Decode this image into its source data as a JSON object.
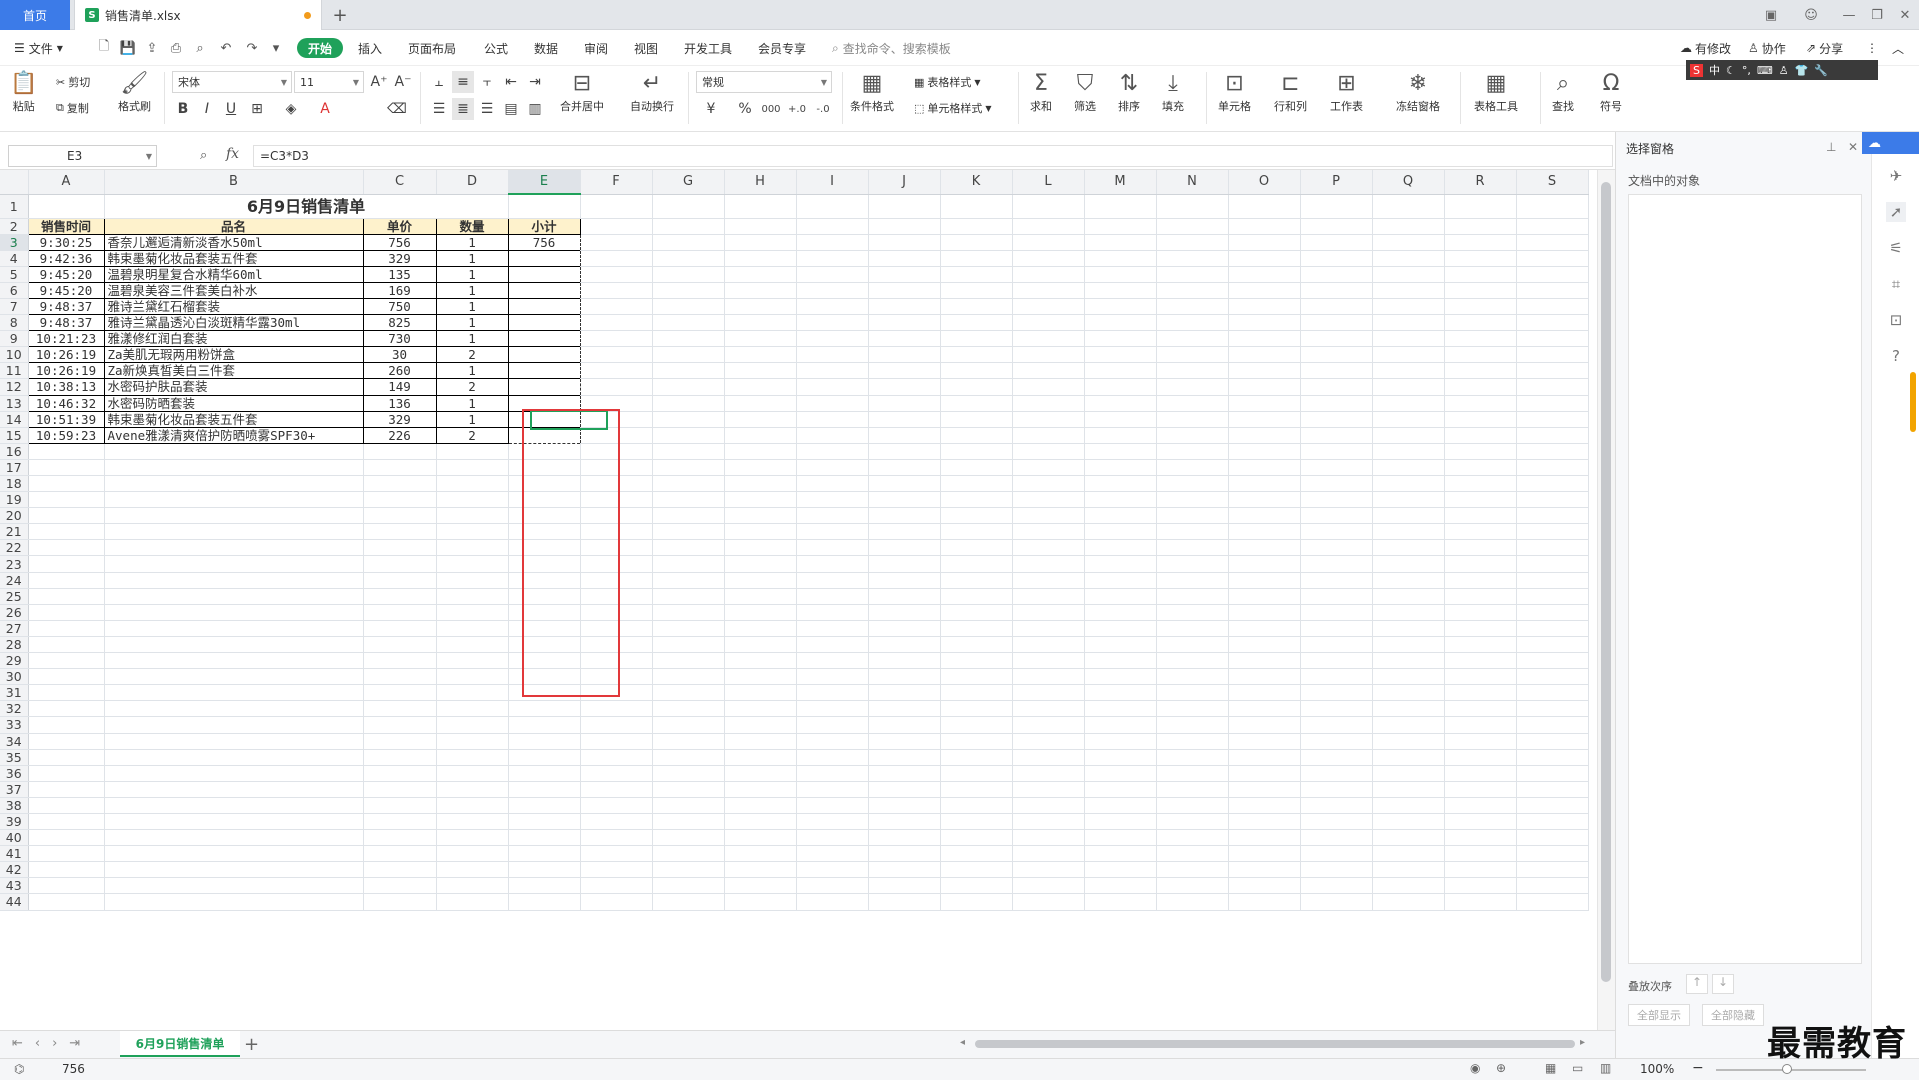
{
  "tabs": {
    "home": "首页",
    "file": "销售清单.xlsx"
  },
  "menu": {
    "file": "文件",
    "items": [
      "开始",
      "插入",
      "页面布局",
      "公式",
      "数据",
      "审阅",
      "视图",
      "开发工具",
      "会员专享"
    ],
    "search_placeholder": "查找命令、搜索模板",
    "right": [
      "有修改",
      "协作",
      "分享"
    ]
  },
  "ribbon": {
    "paste": "粘贴",
    "cut": "剪切",
    "copy": "复制",
    "format_painter": "格式刷",
    "font_name": "宋体",
    "font_size": "11",
    "number_format": "常规",
    "merge": "合并居中",
    "wrap": "自动换行",
    "cond_format": "条件格式",
    "table_style": "表格样式",
    "cell_style": "单元格样式",
    "sum": "求和",
    "filter": "筛选",
    "sort": "排序",
    "fill": "填充",
    "cells": "单元格",
    "rowcol": "行和列",
    "worksheet": "工作表",
    "freeze": "冻结窗格",
    "table_tools": "表格工具",
    "find": "查找",
    "symbol": "符号",
    "currency": "¥",
    "percent": "%",
    "thousands": "000",
    "dec_inc": "+.0",
    "dec_dec": "-.0"
  },
  "formula_bar": {
    "cell_ref": "E3",
    "fx": "fx",
    "formula": "=C3*D3"
  },
  "sheet": {
    "columns": [
      "A",
      "B",
      "C",
      "D",
      "E",
      "F",
      "G",
      "H",
      "I",
      "J",
      "K",
      "L",
      "M",
      "N",
      "O",
      "P",
      "Q",
      "R",
      "S"
    ],
    "title": "6月9日销售清单",
    "headers": [
      "销售时间",
      "品名",
      "单价",
      "数量",
      "小计"
    ],
    "rows": [
      [
        "9:30:25",
        "香奈儿邂逅清新淡香水50ml",
        "756",
        "1",
        "756"
      ],
      [
        "9:42:36",
        "韩束墨菊化妆品套装五件套",
        "329",
        "1",
        ""
      ],
      [
        "9:45:20",
        "温碧泉明星复合水精华60ml",
        "135",
        "1",
        ""
      ],
      [
        "9:45:20",
        "温碧泉美容三件套美白补水",
        "169",
        "1",
        ""
      ],
      [
        "9:48:37",
        "雅诗兰黛红石榴套装",
        "750",
        "1",
        ""
      ],
      [
        "9:48:37",
        "雅诗兰黛晶透沁白淡斑精华露30ml",
        "825",
        "1",
        ""
      ],
      [
        "10:21:23",
        "雅漾修红润白套装",
        "730",
        "1",
        ""
      ],
      [
        "10:26:19",
        "Za美肌无瑕两用粉饼盒",
        "30",
        "2",
        ""
      ],
      [
        "10:26:19",
        "Za新焕真皙美白三件套",
        "260",
        "1",
        ""
      ],
      [
        "10:38:13",
        "水密码护肤品套装",
        "149",
        "2",
        ""
      ],
      [
        "10:46:32",
        "水密码防晒套装",
        "136",
        "1",
        ""
      ],
      [
        "10:51:39",
        "韩束墨菊化妆品套装五件套",
        "329",
        "1",
        ""
      ],
      [
        "10:59:23",
        "Avene雅漾清爽倍护防晒喷雾SPF30+",
        "226",
        "2",
        ""
      ]
    ],
    "row_count": 44,
    "tab_name": "6月9日销售清单"
  },
  "pane": {
    "title": "选择窗格",
    "subtitle": "文档中的对象",
    "order": "叠放次序",
    "show_all": "全部显示",
    "hide_all": "全部隐藏"
  },
  "status": {
    "value": "756",
    "zoom": "100%"
  },
  "watermark": "最需教育",
  "colors": {
    "accent": "#1fa15a",
    "tab_blue": "#3c7be8",
    "highlight_red": "#e2383a",
    "header_yellow": "#fef2cc"
  }
}
